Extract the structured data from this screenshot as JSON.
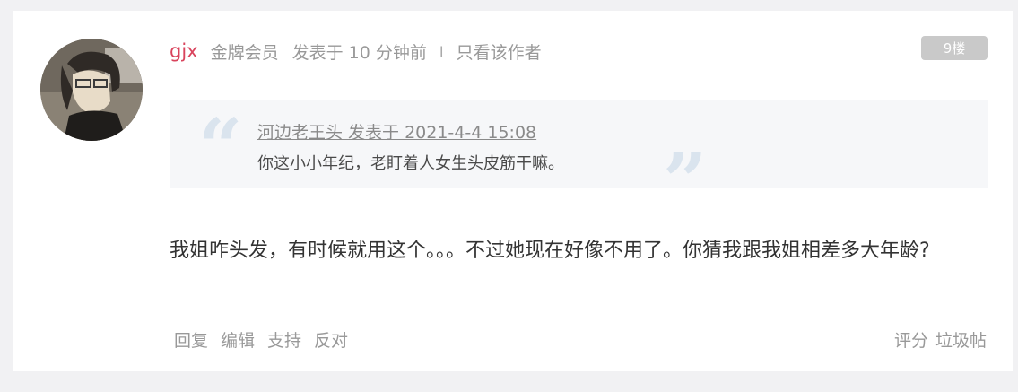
{
  "post": {
    "username": "gjx",
    "rank": "金牌会员",
    "posted": "发表于 10 分钟前",
    "separator": "I",
    "author_only": "只看该作者",
    "floor": "9楼"
  },
  "quote": {
    "header": "河边老王头 发表于 2021-4-4 15:08",
    "text": "你这小小年纪，老盯着人女生头皮筋干嘛。",
    "open_mark": "“",
    "close_mark": "”"
  },
  "content": "我姐咋头发，有时候就用这个。。。不过她现在好像不用了。你猜我跟我姐相差多大年龄?",
  "actions": {
    "reply": "回复",
    "edit": "编辑",
    "support": "支持",
    "oppose": "反对",
    "rate": "评分",
    "spam": "垃圾帖"
  },
  "icons": {
    "avatar": "anime-character-avatar"
  }
}
